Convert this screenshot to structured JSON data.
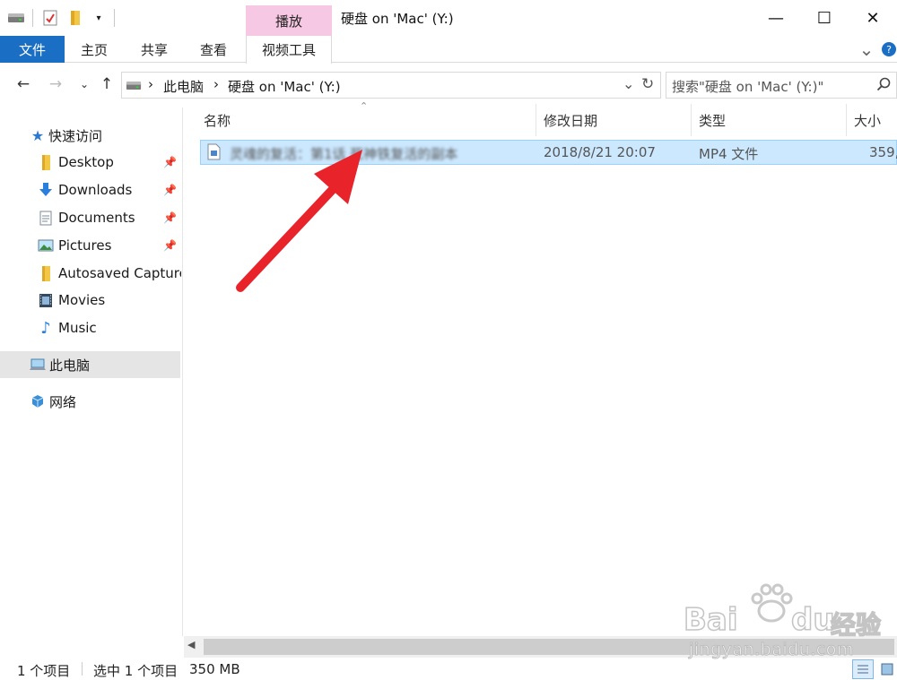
{
  "window": {
    "title": "硬盘 on 'Mac' (Y:)",
    "context_tab_header": "播放",
    "minimize_glyph": "—",
    "maximize_glyph": "☐",
    "close_glyph": "✕"
  },
  "ribbon": {
    "tabs": [
      {
        "label": "文件"
      },
      {
        "label": "主页"
      },
      {
        "label": "共享"
      },
      {
        "label": "查看"
      },
      {
        "label": "视频工具"
      }
    ],
    "expand_glyph": "⌄",
    "help_glyph": "?"
  },
  "address": {
    "breadcrumb": [
      "此电脑",
      "硬盘 on 'Mac' (Y:)"
    ],
    "separator": "›",
    "search_placeholder": "搜索\"硬盘 on 'Mac' (Y:)\""
  },
  "nav": {
    "quick_access": "快速访问",
    "items": [
      {
        "label": "Desktop",
        "pinned": true,
        "icon": "folder-icon"
      },
      {
        "label": "Downloads",
        "pinned": true,
        "icon": "download-icon"
      },
      {
        "label": "Documents",
        "pinned": true,
        "icon": "document-icon"
      },
      {
        "label": "Pictures",
        "pinned": true,
        "icon": "picture-icon"
      },
      {
        "label": "Autosaved Capture",
        "pinned": false,
        "icon": "folder-icon"
      },
      {
        "label": "Movies",
        "pinned": false,
        "icon": "film-icon"
      },
      {
        "label": "Music",
        "pinned": false,
        "icon": "music-note-icon"
      }
    ],
    "this_pc": "此电脑",
    "network": "网络"
  },
  "filelist": {
    "columns": [
      "名称",
      "修改日期",
      "类型",
      "大小"
    ],
    "rows": [
      {
        "name": "灵魂的复活：第1话 死神铁复活的副本",
        "modified": "2018/8/21 20:07",
        "type": "MP4 文件",
        "size": "359,("
      }
    ]
  },
  "status": {
    "item_count": "1 个项目",
    "selection": "选中 1 个项目",
    "size": "350 MB"
  },
  "watermark": {
    "brand": "Bai",
    "brand_suffix": "du",
    "cn": "经验",
    "url": "jingyan.baidu.com"
  },
  "colors": {
    "accent": "#1a6fc4",
    "selection": "#cce8ff",
    "context_tab": "#f6c8e3",
    "arrow": "#e8232a"
  }
}
